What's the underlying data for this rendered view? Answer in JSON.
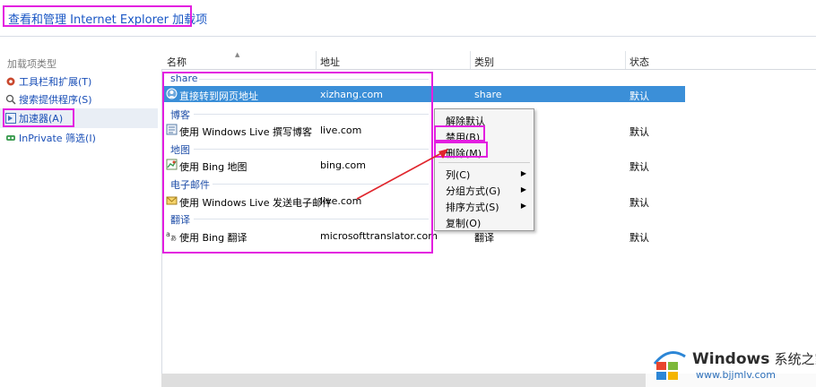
{
  "window": {
    "title": "查看和管理 Internet Explorer 加载项"
  },
  "sidebar": {
    "heading": "加载项类型",
    "items": [
      {
        "label": "工具栏和扩展(T)",
        "icon": "gear-icon"
      },
      {
        "label": "搜索提供程序(S)",
        "icon": "search-icon"
      },
      {
        "label": "加速器(A)",
        "icon": "accelerator-icon"
      },
      {
        "label": "InPrivate 筛选(I)",
        "icon": "inprivate-icon"
      }
    ]
  },
  "table": {
    "columns": [
      "名称",
      "地址",
      "类别",
      "状态"
    ],
    "groups": [
      {
        "label": "share",
        "rows": [
          {
            "name": "直接转到网页地址",
            "address": "xizhang.com",
            "category": "share",
            "status": "默认"
          }
        ]
      },
      {
        "label": "博客",
        "rows": [
          {
            "name": "使用 Windows Live 撰写博客",
            "address": "live.com",
            "category": "",
            "status": "默认"
          }
        ]
      },
      {
        "label": "地图",
        "rows": [
          {
            "name": "使用 Bing 地图",
            "address": "bing.com",
            "category": "",
            "status": "默认"
          }
        ]
      },
      {
        "label": "电子邮件",
        "rows": [
          {
            "name": "使用 Windows Live 发送电子邮件",
            "address": "live.com",
            "category": "",
            "status": "默认"
          }
        ]
      },
      {
        "label": "翻译",
        "rows": [
          {
            "name": "使用 Bing 翻译",
            "address": "microsofttranslator.com",
            "category": "翻译",
            "status": "默认"
          }
        ]
      }
    ]
  },
  "context_menu": {
    "items": [
      "解除默认",
      "禁用(B)",
      "删除(M)",
      "列(C)",
      "分组方式(G)",
      "排序方式(S)",
      "复制(O)"
    ]
  },
  "watermark": {
    "brand": "Windows",
    "brand_suffix": "系统之家",
    "url": "www.bjjmlv.com"
  },
  "colors": {
    "accent": "#e31ee0",
    "selection": "#3b8fd8",
    "link": "#1a57c5"
  }
}
